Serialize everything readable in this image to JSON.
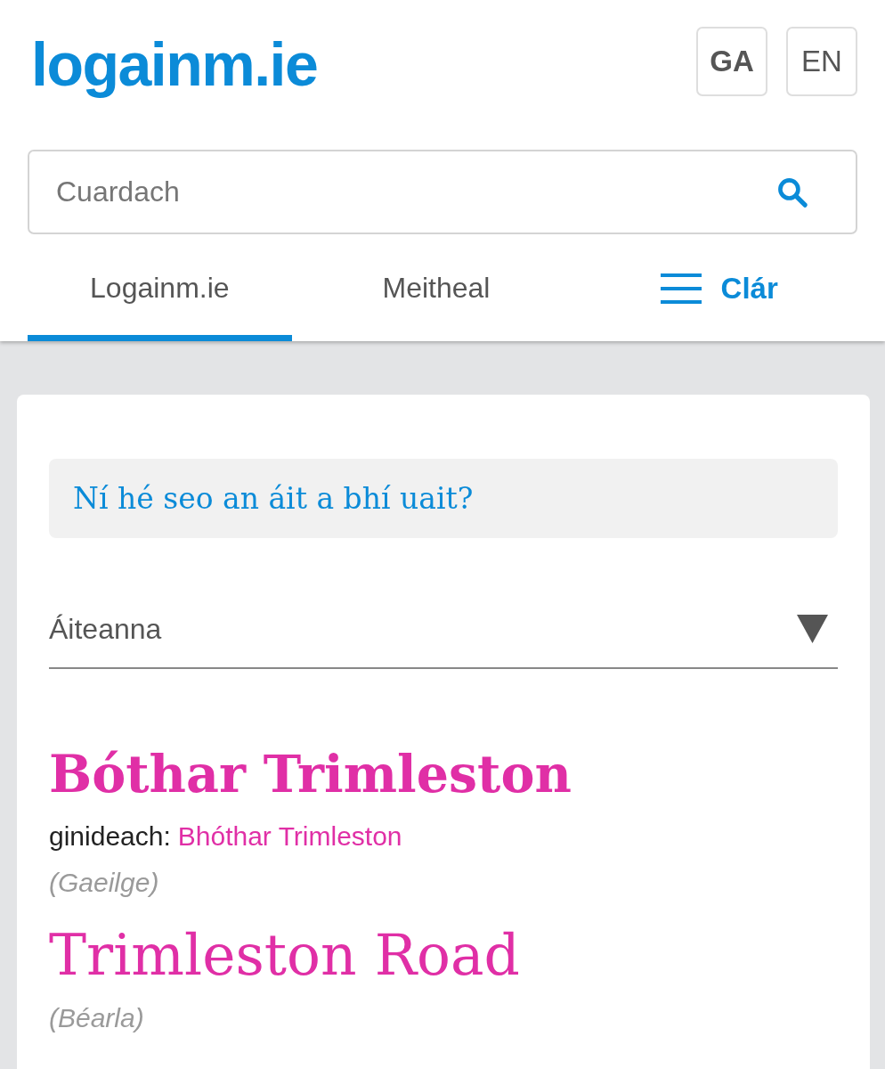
{
  "header": {
    "logo": "logainm.ie",
    "languages": [
      {
        "label": "GA",
        "selected": true
      },
      {
        "label": "EN",
        "selected": false
      }
    ]
  },
  "search": {
    "placeholder": "Cuardach"
  },
  "nav": {
    "tabs": [
      {
        "label": "Logainm.ie",
        "selected": true
      },
      {
        "label": "Meitheal",
        "selected": false
      }
    ],
    "menu": {
      "label": "Clár"
    }
  },
  "card": {
    "notice": "Ní hé seo an áit a bhí uait?",
    "dropdown": {
      "value": "Áiteanna"
    },
    "entries": [
      {
        "kind": "primary",
        "name": "Bóthar Trimleston",
        "genitive_label": "ginideach:",
        "genitive": "Bhóthar Trimleston",
        "language": "(Gaeilge)"
      },
      {
        "kind": "secondary",
        "name": "Trimleston Road",
        "language": "(Béarla)"
      }
    ]
  }
}
